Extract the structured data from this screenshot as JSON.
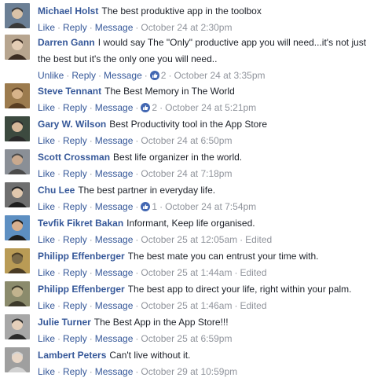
{
  "actions": {
    "like": "Like",
    "unlike": "Unlike",
    "reply": "Reply",
    "message": "Message",
    "separator": "·",
    "edited": "Edited"
  },
  "colors": {
    "link": "#365899",
    "meta": "#90949c",
    "like_badge": "#4267b2"
  },
  "comments": [
    {
      "author": "Michael Holst",
      "text": "The best produktive app in the toolbox",
      "action": "Like",
      "likes": "",
      "time": "October 24 at 2:30pm",
      "edited": ""
    },
    {
      "author": "Darren Gann",
      "text": "I would say The \"Only\" productive app you will need...it's not just the best but it's the only one you will need..",
      "action": "Unlike",
      "likes": "2",
      "time": "October 24 at 3:35pm",
      "edited": ""
    },
    {
      "author": "Steve Tennant",
      "text": "The Best Memory in The World",
      "action": "Like",
      "likes": "2",
      "time": "October 24 at 5:21pm",
      "edited": ""
    },
    {
      "author": "Gary W. Wilson",
      "text": "Best Productivity tool in the App Store",
      "action": "Like",
      "likes": "",
      "time": "October 24 at 6:50pm",
      "edited": ""
    },
    {
      "author": "Scott Crossman",
      "text": "Best life organizer in the world.",
      "action": "Like",
      "likes": "",
      "time": "October 24 at 7:18pm",
      "edited": ""
    },
    {
      "author": "Chu Lee",
      "text": "The best partner in everyday life.",
      "action": "Like",
      "likes": "1",
      "time": "October 24 at 7:54pm",
      "edited": ""
    },
    {
      "author": "Tevfik Fikret Bakan",
      "text": "Informant, Keep life organised.",
      "action": "Like",
      "likes": "",
      "time": "October 25 at 12:05am",
      "edited": "Edited"
    },
    {
      "author": "Philipp Effenberger",
      "text": "The best mate you can entrust your time with.",
      "action": "Like",
      "likes": "",
      "time": "October 25 at 1:44am",
      "edited": "Edited"
    },
    {
      "author": "Philipp Effenberger",
      "text": "The best app to direct your life, right within your palm.",
      "action": "Like",
      "likes": "",
      "time": "October 25 at 1:46am",
      "edited": "Edited"
    },
    {
      "author": "Julie Turner",
      "text": "The Best App in the App Store!!!",
      "action": "Like",
      "likes": "",
      "time": "October 25 at 6:59pm",
      "edited": ""
    },
    {
      "author": "Lambert Peters",
      "text": "Can't live without it.",
      "action": "Like",
      "likes": "",
      "time": "October 29 at 10:59pm",
      "edited": ""
    }
  ]
}
